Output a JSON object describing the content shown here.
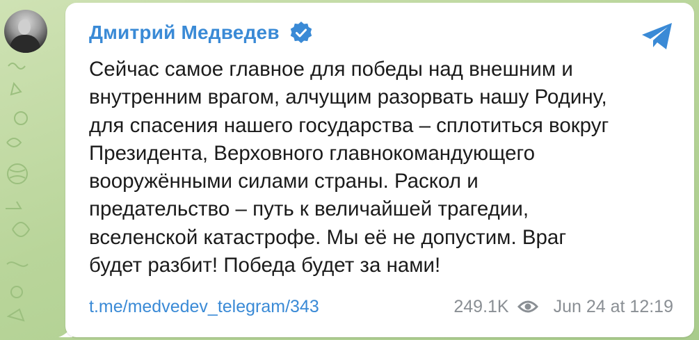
{
  "post": {
    "author": "Дмитрий Медведев",
    "verified_icon": "verified-badge-icon",
    "share_icon": "telegram-share-icon",
    "text": "Сейчас самое главное для победы над внешним и\nвнутренним врагом, алчущим разорвать нашу Родину,\nдля спасения нашего государства – сплотиться вокруг\nПрезидента, Верховного главнокомандующего\nвооружёнными силами страны. Раскол и\nпредательство – путь к величайшей трагедии,\nвселенской катастрофе. Мы её не допустим. Враг\nбудет разбит! Победа будет за нами!",
    "link": "t.me/medvedev_telegram/343",
    "views": "249.1K",
    "views_icon": "eye-icon",
    "timestamp": "Jun 24 at 12:19"
  },
  "colors": {
    "author": "#3a8ad6",
    "link": "#3a8ad6",
    "meta": "#8a8f94",
    "background": "#b9d59a"
  }
}
